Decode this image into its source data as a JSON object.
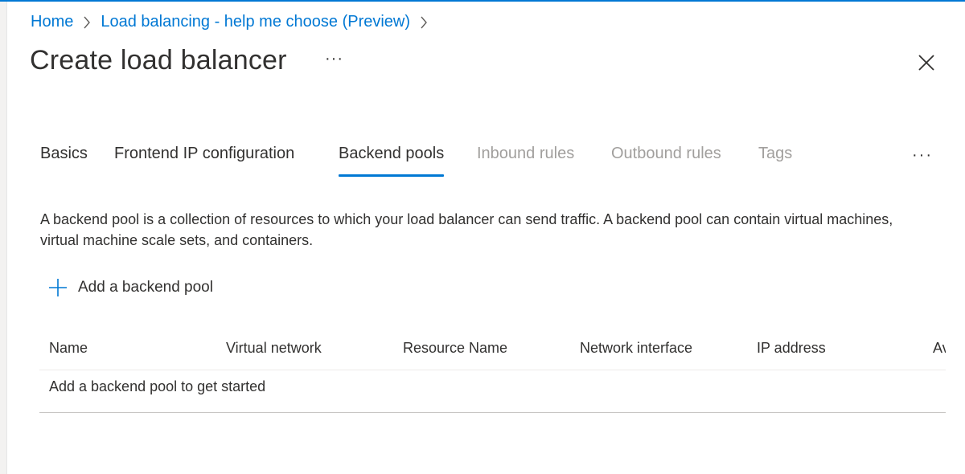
{
  "breadcrumb": {
    "items": [
      "Home",
      "Load balancing - help me choose (Preview)"
    ]
  },
  "header": {
    "title": "Create load balancer",
    "more_label": "···"
  },
  "tabs": {
    "items": [
      {
        "label": "Basics",
        "state": "enabled"
      },
      {
        "label": "Frontend IP configuration",
        "state": "enabled"
      },
      {
        "label": "Backend pools",
        "state": "active"
      },
      {
        "label": "Inbound rules",
        "state": "disabled"
      },
      {
        "label": "Outbound rules",
        "state": "disabled"
      },
      {
        "label": "Tags",
        "state": "disabled"
      }
    ],
    "more_label": "···"
  },
  "content": {
    "description": "A backend pool is a collection of resources to which your load balancer can send traffic. A backend pool can contain virtual machines, virtual machine scale sets, and containers.",
    "add_label": "Add a backend pool"
  },
  "table": {
    "columns": [
      "Name",
      "Virtual network",
      "Resource Name",
      "Network interface",
      "IP address",
      "Av"
    ],
    "empty_message": "Add a backend pool to get started"
  },
  "colors": {
    "accent": "#0078d4",
    "text": "#323130",
    "disabled_text": "#a19f9d"
  },
  "icons": {
    "breadcrumb_separator": "chevron-right-icon",
    "close": "close-icon",
    "add": "plus-icon"
  }
}
